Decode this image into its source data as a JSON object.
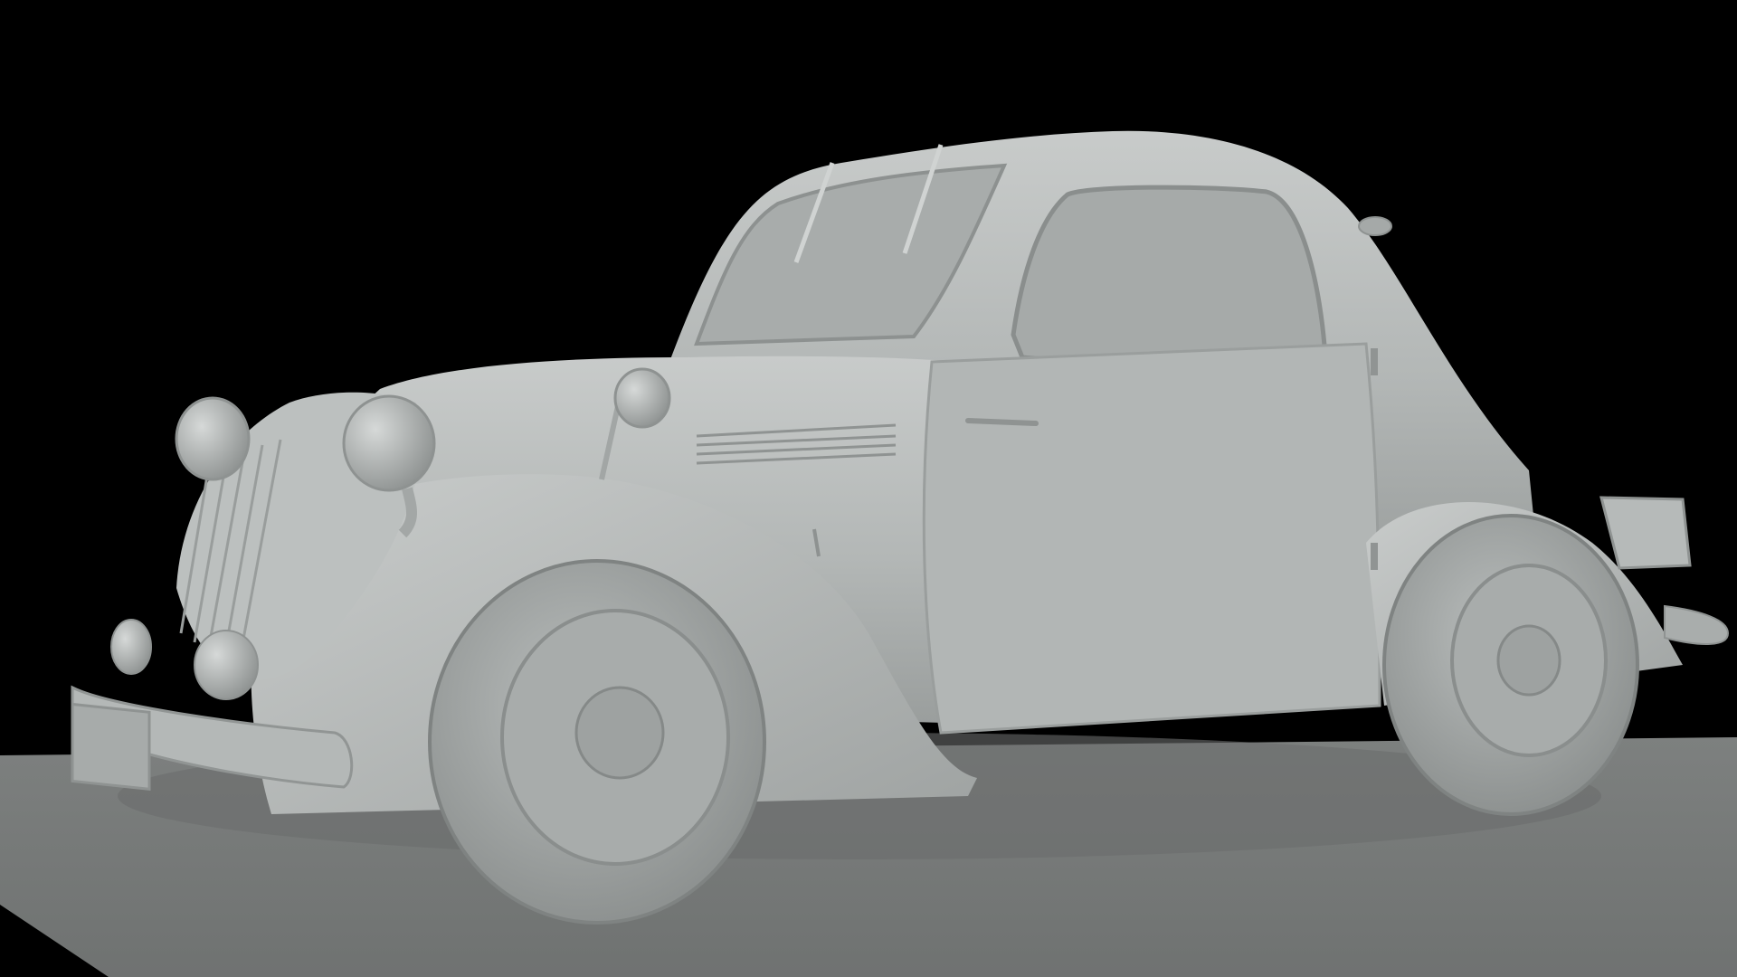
{
  "scene": {
    "subject": "car-icon",
    "colors": {
      "background": "#000000",
      "floor": "#7e8180",
      "body_light": "#c3c6c5",
      "body_mid": "#a9adac",
      "body_dark": "#8c908f",
      "glass": "#a6aaa9",
      "rubber": "#9da1a0"
    }
  }
}
